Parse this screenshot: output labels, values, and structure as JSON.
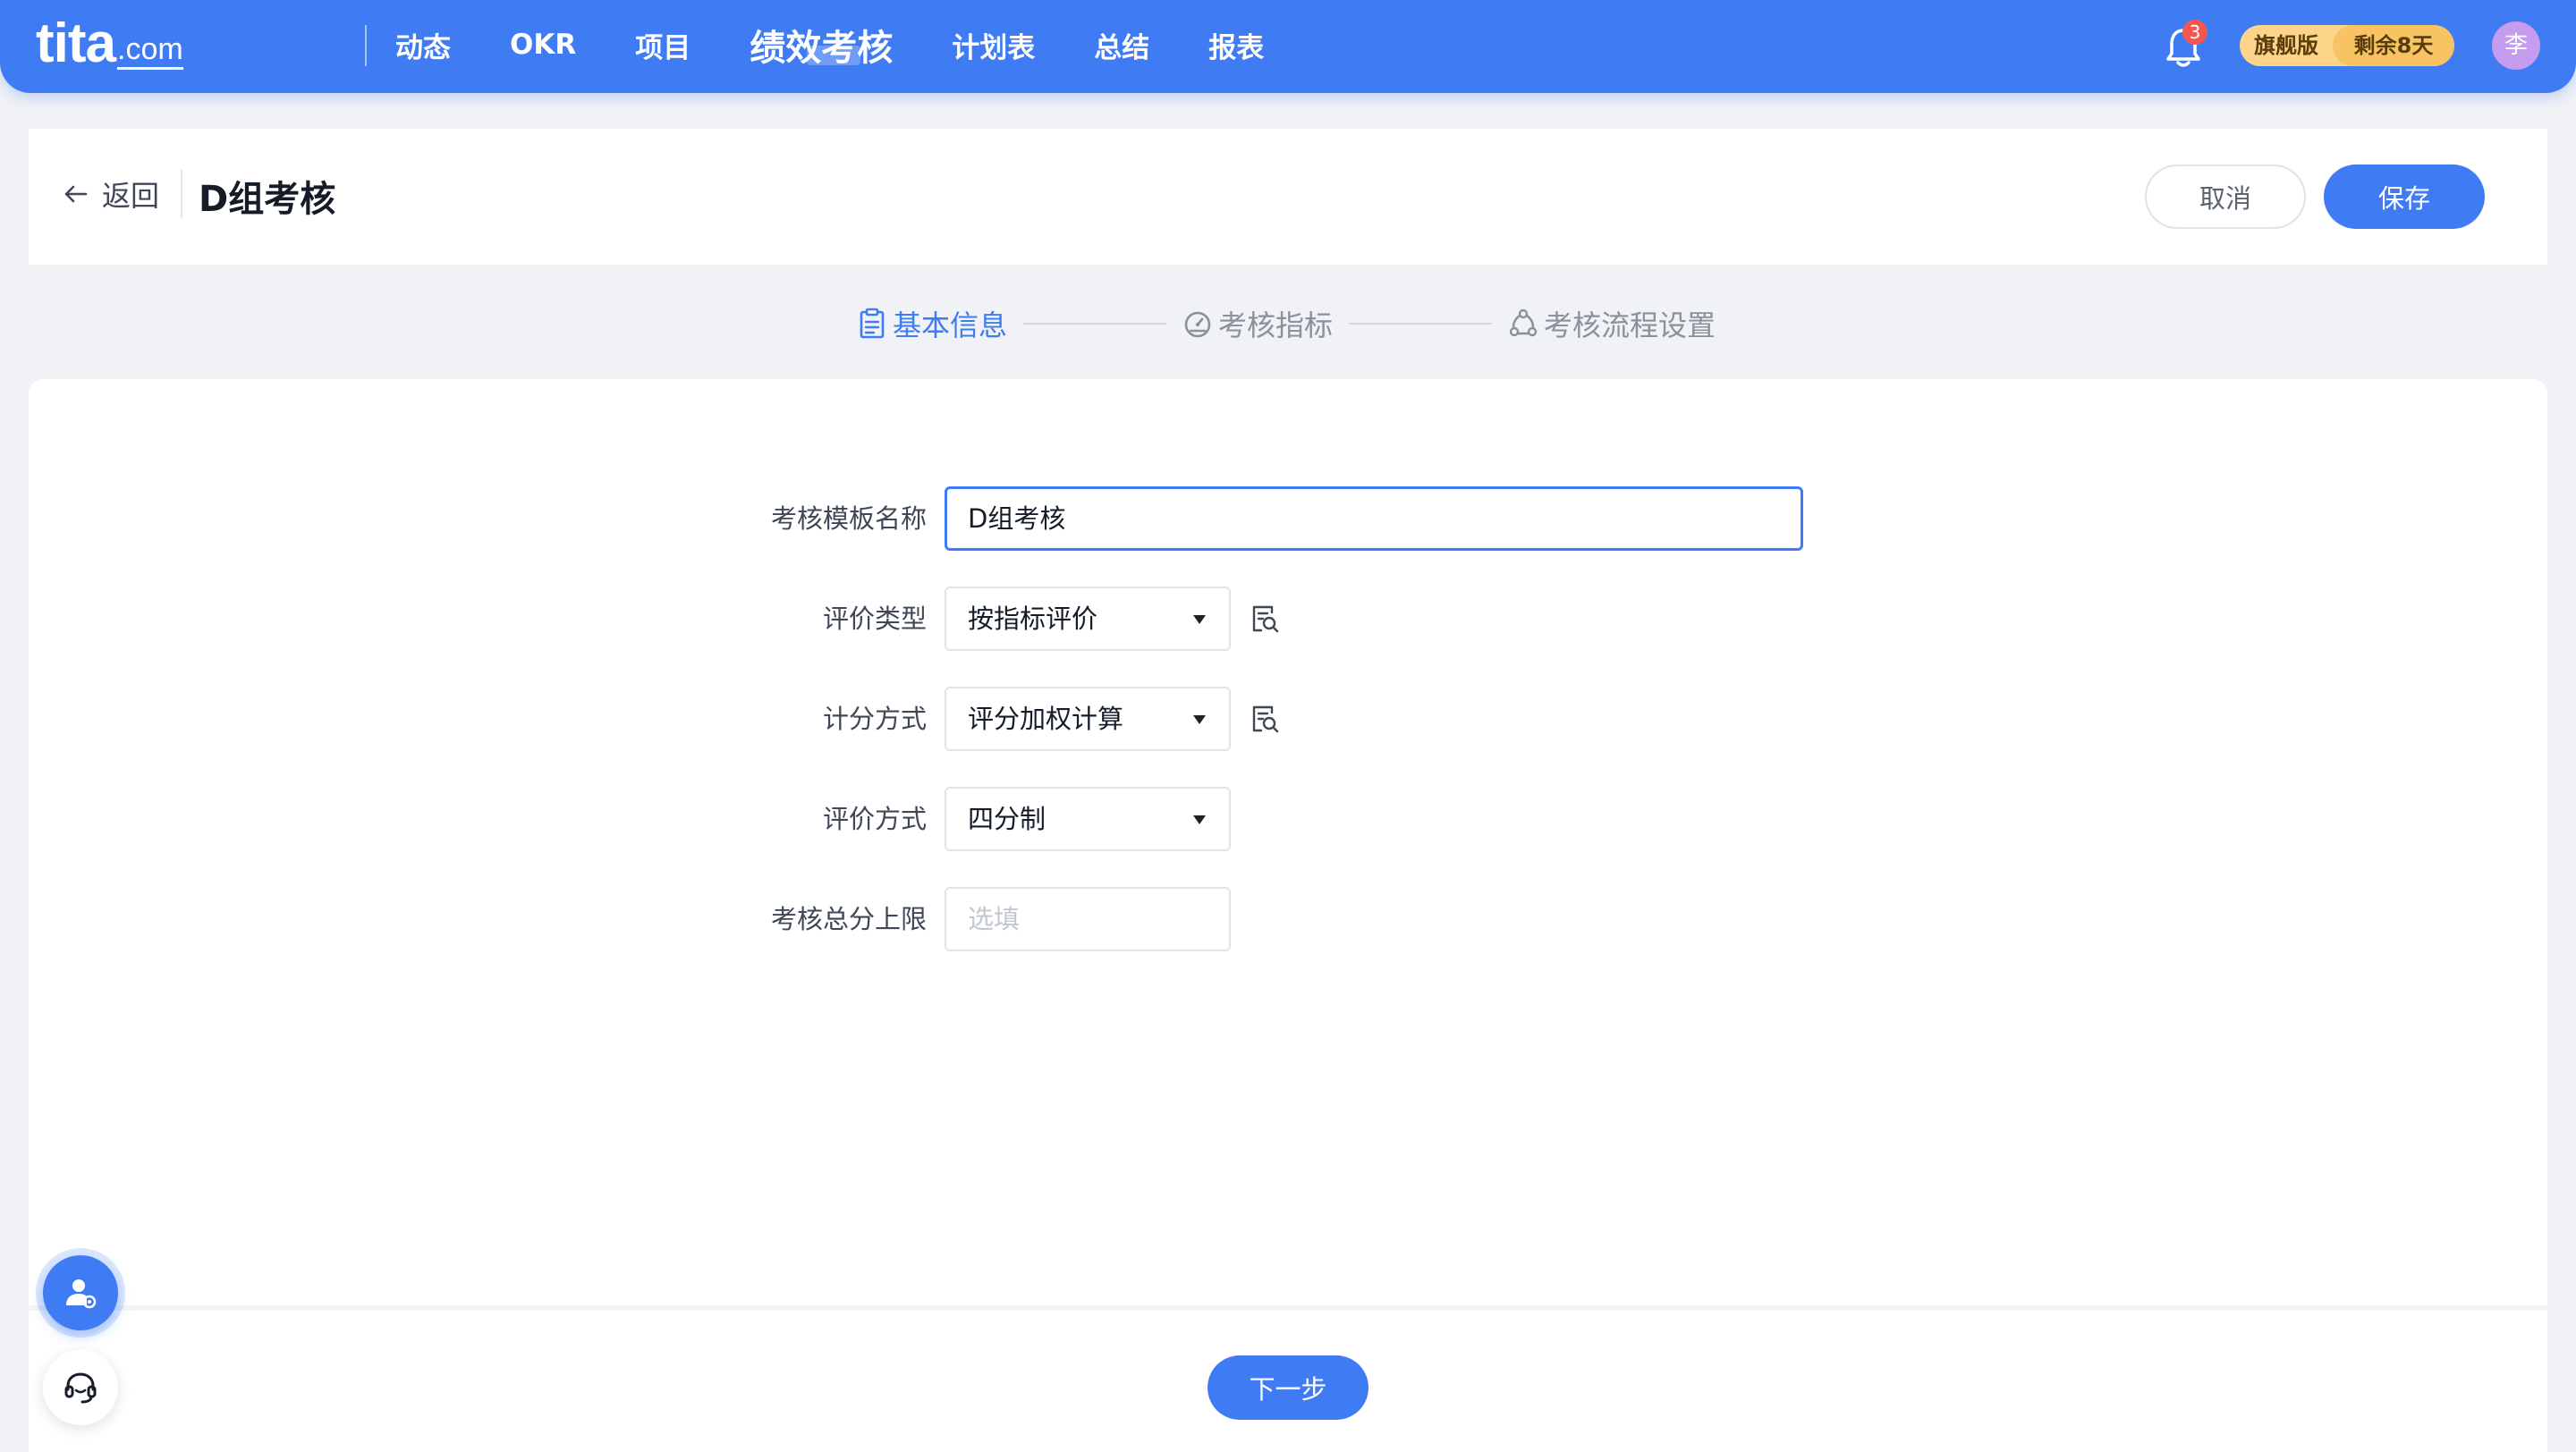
{
  "brand": {
    "logo_main": "tita",
    "logo_sub": ".com"
  },
  "nav": {
    "items": [
      {
        "label": "动态"
      },
      {
        "label": "OKR"
      },
      {
        "label": "项目"
      },
      {
        "label": "绩效考核"
      },
      {
        "label": "计划表"
      },
      {
        "label": "总结"
      },
      {
        "label": "报表"
      }
    ],
    "active": "绩效考核",
    "notification_count": "3",
    "plan_name": "旗舰版",
    "plan_remaining": "剩余8天",
    "avatar_text": "李"
  },
  "header": {
    "back_label": "返回",
    "title": "D组考核",
    "cancel_label": "取消",
    "save_label": "保存"
  },
  "steps": [
    {
      "label": "基本信息",
      "icon": "clipboard-icon",
      "active": true
    },
    {
      "label": "考核指标",
      "icon": "gauge-icon",
      "active": false
    },
    {
      "label": "考核流程设置",
      "icon": "flow-icon",
      "active": false
    }
  ],
  "form": {
    "template_name": {
      "label": "考核模板名称",
      "value": "D组考核"
    },
    "evaluation_type": {
      "label": "评价类型",
      "value": "按指标评价"
    },
    "scoring_method": {
      "label": "计分方式",
      "value": "评分加权计算"
    },
    "rating_method": {
      "label": "评价方式",
      "value": "四分制"
    },
    "score_limit": {
      "label": "考核总分上限",
      "placeholder": "选填"
    }
  },
  "footer": {
    "next_label": "下一步"
  },
  "colors": {
    "primary": "#3f7bf2",
    "plan_gold": "#f8c463",
    "badge_red": "#f5564e",
    "avatar_purple": "#c69cf0"
  }
}
